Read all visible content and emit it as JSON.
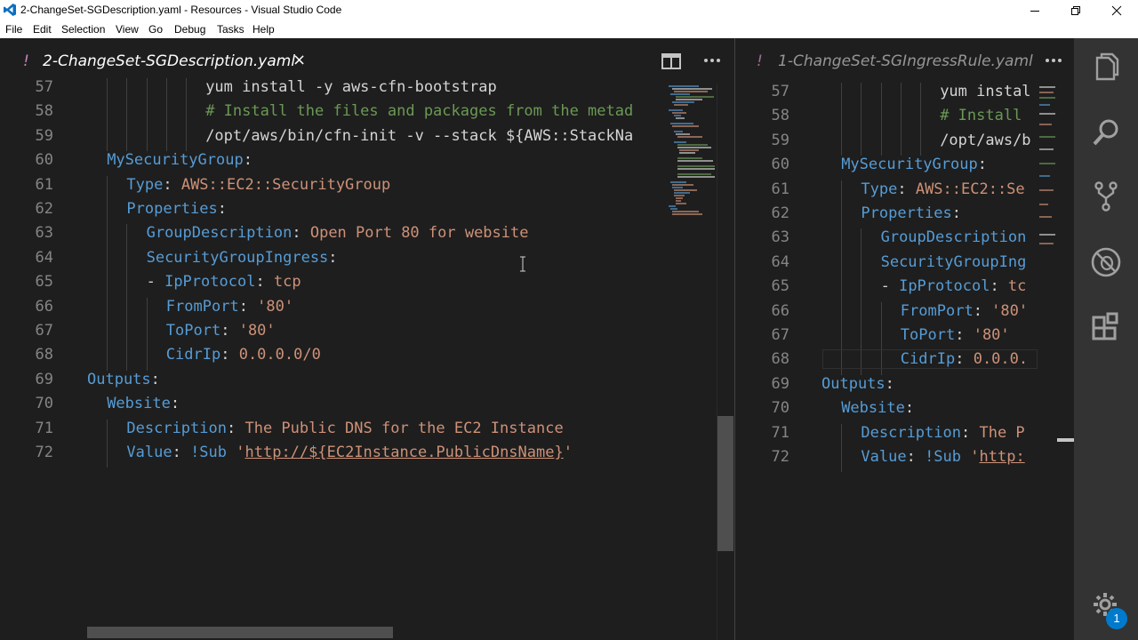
{
  "window": {
    "title": "2-ChangeSet-SGDescription.yaml - Resources - Visual Studio Code"
  },
  "menu": [
    "File",
    "Edit",
    "Selection",
    "View",
    "Go",
    "Debug",
    "Tasks",
    "Help"
  ],
  "left_editor": {
    "tab_dirty_marker": "!",
    "tab_label": "2-ChangeSet-SGDescription.yaml",
    "tab_close": "×",
    "lines": [
      {
        "n": "57",
        "i": 6,
        "parts": [
          [
            "yum install -y aws-cfn-bootstrap",
            "p"
          ]
        ]
      },
      {
        "n": "58",
        "i": 6,
        "parts": [
          [
            "# Install the files and packages from the metad",
            "c"
          ]
        ]
      },
      {
        "n": "59",
        "i": 6,
        "parts": [
          [
            "/opt/aws/bin/cfn-init -v --stack ${AWS::StackNa",
            "p"
          ]
        ]
      },
      {
        "n": "60",
        "i": 1,
        "parts": [
          [
            "MySecurityGroup",
            "k"
          ],
          [
            ":",
            "p"
          ]
        ]
      },
      {
        "n": "61",
        "i": 2,
        "parts": [
          [
            "Type",
            "k"
          ],
          [
            ": ",
            "p"
          ],
          [
            "AWS::EC2::SecurityGroup",
            "s"
          ]
        ]
      },
      {
        "n": "62",
        "i": 2,
        "parts": [
          [
            "Properties",
            "k"
          ],
          [
            ":",
            "p"
          ]
        ]
      },
      {
        "n": "63",
        "i": 3,
        "parts": [
          [
            "GroupDescription",
            "k"
          ],
          [
            ": ",
            "p"
          ],
          [
            "Open Port 80 for website",
            "s"
          ]
        ]
      },
      {
        "n": "64",
        "i": 3,
        "parts": [
          [
            "SecurityGroupIngress",
            "k"
          ],
          [
            ":",
            "p"
          ]
        ]
      },
      {
        "n": "65",
        "i": 3,
        "parts": [
          [
            "- ",
            "p"
          ],
          [
            "IpProtocol",
            "k"
          ],
          [
            ": ",
            "p"
          ],
          [
            "tcp",
            "s"
          ]
        ]
      },
      {
        "n": "66",
        "i": 4,
        "parts": [
          [
            "FromPort",
            "k"
          ],
          [
            ": ",
            "p"
          ],
          [
            "'80'",
            "s"
          ]
        ]
      },
      {
        "n": "67",
        "i": 4,
        "parts": [
          [
            "ToPort",
            "k"
          ],
          [
            ": ",
            "p"
          ],
          [
            "'80'",
            "s"
          ]
        ]
      },
      {
        "n": "68",
        "i": 4,
        "parts": [
          [
            "CidrIp",
            "k"
          ],
          [
            ": ",
            "p"
          ],
          [
            "0.0.0.0/0",
            "s"
          ]
        ]
      },
      {
        "n": "69",
        "i": 0,
        "parts": [
          [
            "Outputs",
            "k"
          ],
          [
            ":",
            "p"
          ]
        ]
      },
      {
        "n": "70",
        "i": 1,
        "parts": [
          [
            "Website",
            "k"
          ],
          [
            ":",
            "p"
          ]
        ]
      },
      {
        "n": "71",
        "i": 2,
        "parts": [
          [
            "Description",
            "k"
          ],
          [
            ": ",
            "p"
          ],
          [
            "The Public DNS for the EC2 Instance",
            "s"
          ]
        ]
      },
      {
        "n": "72",
        "i": 2,
        "parts": [
          [
            "Value",
            "k"
          ],
          [
            ": ",
            "p"
          ],
          [
            "!Sub ",
            "k"
          ],
          [
            "'",
            "s"
          ],
          [
            "http://${EC2Instance.PublicDnsName}",
            "u"
          ],
          [
            "'",
            "s"
          ]
        ]
      }
    ]
  },
  "right_editor": {
    "tab_dirty_marker": "!",
    "tab_label": "1-ChangeSet-SGIngressRule.yaml",
    "lines": [
      {
        "n": "57",
        "i": 6,
        "parts": [
          [
            "yum instal",
            "p"
          ]
        ]
      },
      {
        "n": "58",
        "i": 6,
        "parts": [
          [
            "# Install ",
            "c"
          ]
        ]
      },
      {
        "n": "59",
        "i": 6,
        "parts": [
          [
            "/opt/aws/b",
            "p"
          ]
        ]
      },
      {
        "n": "60",
        "i": 1,
        "parts": [
          [
            "MySecurityGroup",
            "k"
          ],
          [
            ":",
            "p"
          ]
        ]
      },
      {
        "n": "61",
        "i": 2,
        "parts": [
          [
            "Type",
            "k"
          ],
          [
            ": ",
            "p"
          ],
          [
            "AWS::EC2::Se",
            "s"
          ]
        ]
      },
      {
        "n": "62",
        "i": 2,
        "parts": [
          [
            "Properties",
            "k"
          ],
          [
            ":",
            "p"
          ]
        ]
      },
      {
        "n": "63",
        "i": 3,
        "parts": [
          [
            "GroupDescription",
            "k"
          ]
        ]
      },
      {
        "n": "64",
        "i": 3,
        "parts": [
          [
            "SecurityGroupIng",
            "k"
          ]
        ]
      },
      {
        "n": "65",
        "i": 3,
        "parts": [
          [
            "- ",
            "p"
          ],
          [
            "IpProtocol",
            "k"
          ],
          [
            ": ",
            "p"
          ],
          [
            "tc",
            "s"
          ]
        ]
      },
      {
        "n": "66",
        "i": 4,
        "parts": [
          [
            "FromPort",
            "k"
          ],
          [
            ": ",
            "p"
          ],
          [
            "'80'",
            "s"
          ]
        ]
      },
      {
        "n": "67",
        "i": 4,
        "parts": [
          [
            "ToPort",
            "k"
          ],
          [
            ": ",
            "p"
          ],
          [
            "'80'",
            "s"
          ]
        ]
      },
      {
        "n": "68",
        "i": 4,
        "parts": [
          [
            "CidrIp",
            "k"
          ],
          [
            ": ",
            "p"
          ],
          [
            "0.0.0.",
            "s"
          ]
        ]
      },
      {
        "n": "69",
        "i": 0,
        "parts": [
          [
            "Outputs",
            "k"
          ],
          [
            ":",
            "p"
          ]
        ]
      },
      {
        "n": "70",
        "i": 1,
        "parts": [
          [
            "Website",
            "k"
          ],
          [
            ":",
            "p"
          ]
        ]
      },
      {
        "n": "71",
        "i": 2,
        "parts": [
          [
            "Description",
            "k"
          ],
          [
            ": ",
            "p"
          ],
          [
            "The P",
            "s"
          ]
        ]
      },
      {
        "n": "72",
        "i": 2,
        "parts": [
          [
            "Value",
            "k"
          ],
          [
            ": ",
            "p"
          ],
          [
            "!Sub ",
            "k"
          ],
          [
            "'",
            "s"
          ],
          [
            "http:",
            "u"
          ]
        ]
      }
    ]
  },
  "activity_bar": {
    "icons": [
      "explorer-icon",
      "search-icon",
      "source-control-icon",
      "debug-icon",
      "extensions-icon",
      "settings-gear-icon"
    ],
    "badge": "1"
  },
  "colors": {
    "keyword": "#569cd6",
    "string": "#ce9178",
    "comment": "#6a9955",
    "plain": "#d4d4d4",
    "dirty": "#c586c0",
    "badge": "#007acc"
  }
}
